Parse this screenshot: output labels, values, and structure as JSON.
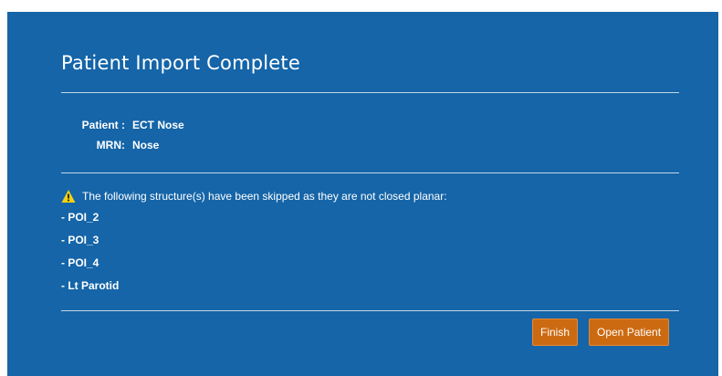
{
  "dialog": {
    "title": "Patient Import Complete"
  },
  "patient": {
    "patient_label": "Patient :",
    "patient_value": "ECT Nose",
    "mrn_label": "MRN:",
    "mrn_value": "Nose"
  },
  "warning": {
    "icon": "warning-triangle-icon",
    "icon_color": "#f2d20f",
    "message": "The following structure(s) have been skipped as they are not closed planar:",
    "items": [
      "- POI_2",
      "- POI_3",
      "- POI_4",
      "- Lt Parotid"
    ]
  },
  "buttons": {
    "finish_label": "Finish",
    "open_patient_label": "Open Patient"
  },
  "colors": {
    "dialog_background": "#1565a8",
    "button_background": "#cc6a12"
  }
}
